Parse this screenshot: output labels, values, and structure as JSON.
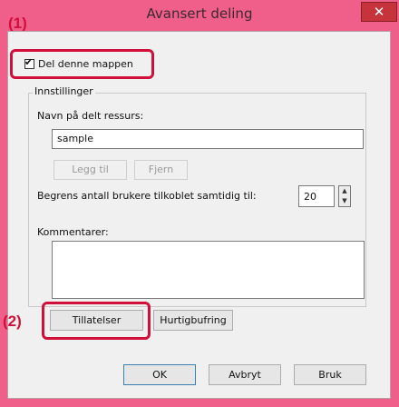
{
  "window": {
    "title": "Avansert deling",
    "close_glyph": "✕"
  },
  "callouts": {
    "one": "(1)",
    "two": "(2)"
  },
  "share": {
    "checkbox_label": "Del denne mappen",
    "checked": true
  },
  "settings": {
    "legend": "Innstillinger",
    "share_name_label": "Navn på delt ressurs:",
    "share_name_value": "sample",
    "add_button": "Legg til",
    "remove_button": "Fjern",
    "limit_label": "Begrens antall brukere tilkoblet samtidig til:",
    "limit_value": "20",
    "comments_label": "Kommentarer:",
    "comments_value": ""
  },
  "actions": {
    "permissions_button": "Tillatelser",
    "caching_button": "Hurtigbufring"
  },
  "footer": {
    "ok": "OK",
    "cancel": "Avbryt",
    "apply": "Bruk"
  },
  "icons": {
    "spin_up": "▲",
    "spin_down": "▼"
  },
  "colors": {
    "callout_red": "#d0103a",
    "window_frame": "#ef5f8a",
    "close_button": "#c7333a"
  }
}
